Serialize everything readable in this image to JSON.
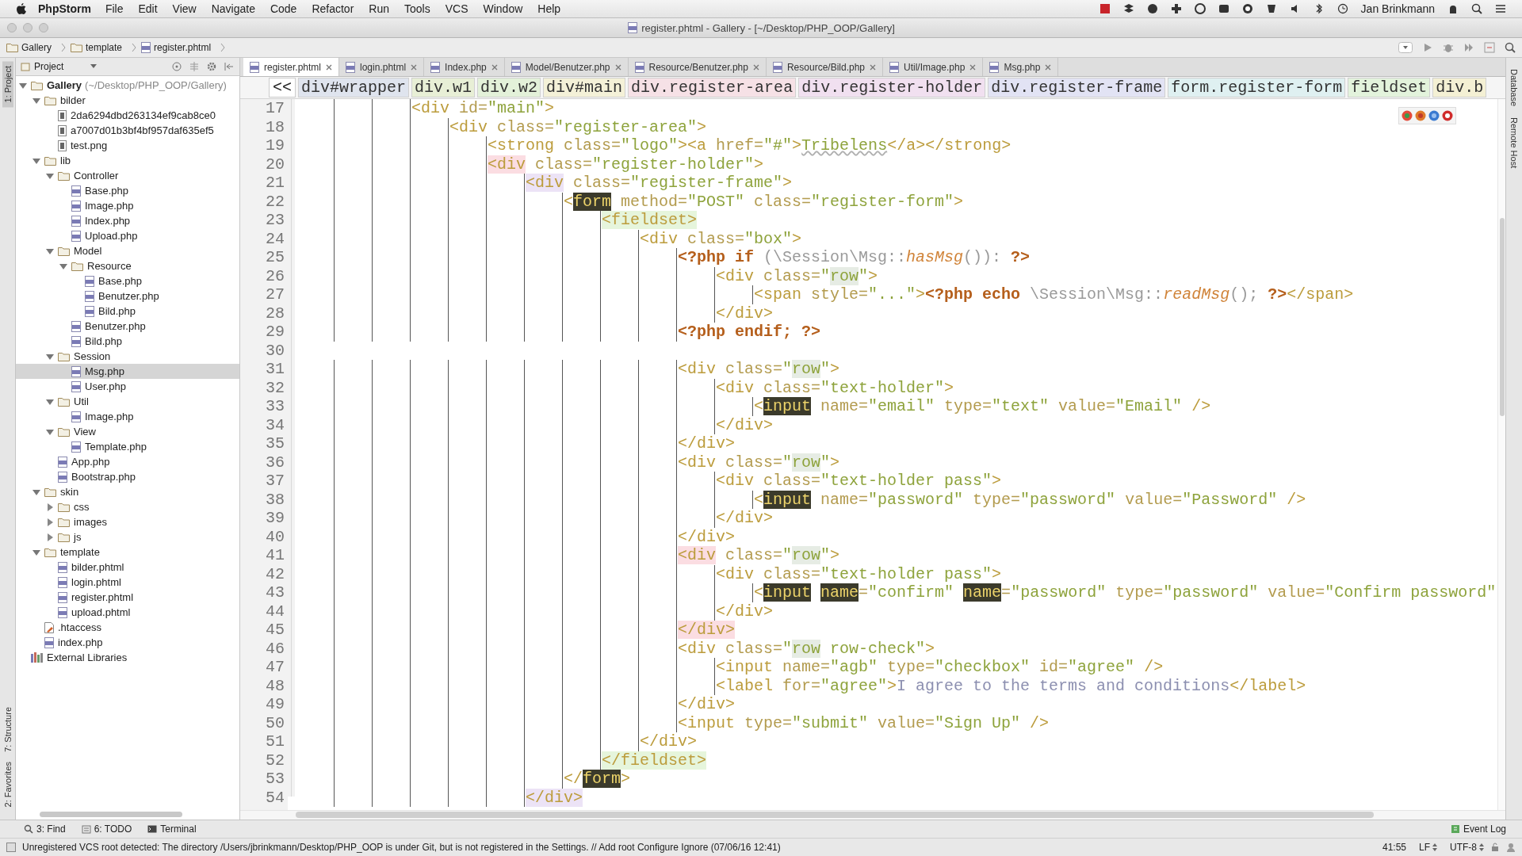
{
  "menu_bar": {
    "app": "PhpStorm",
    "items": [
      "File",
      "Edit",
      "View",
      "Navigate",
      "Code",
      "Refactor",
      "Run",
      "Tools",
      "VCS",
      "Window",
      "Help"
    ],
    "user": "Jan Brinkmann"
  },
  "window": {
    "title": "register.phtml - Gallery - [~/Desktop/PHP_OOP/Gallery]"
  },
  "navigation_bar": [
    {
      "kind": "folder",
      "label": "Gallery"
    },
    {
      "kind": "folder",
      "label": "template"
    },
    {
      "kind": "php",
      "label": "register.phtml"
    }
  ],
  "left_tool_tabs": [
    {
      "label": "1: Project",
      "selected": true
    },
    {
      "label": "7: Structure",
      "selected": false
    },
    {
      "label": "2: Favorites",
      "selected": false
    }
  ],
  "right_tool_tabs": [
    "Database",
    "Remote Host"
  ],
  "project": {
    "view": "Project",
    "tree": [
      {
        "kind": "folder",
        "name": "Gallery",
        "path": "(~/Desktop/PHP_OOP/Gallery)",
        "expanded": true,
        "selected": false,
        "children": [
          {
            "kind": "folder",
            "name": "bilder",
            "expanded": true,
            "selected": false,
            "children": [
              {
                "kind": "file",
                "name": "2da6294dbd263134ef9cab8ce0",
                "selected": false
              },
              {
                "kind": "file",
                "name": "a7007d01b3bf4bf957daf635ef5",
                "selected": false
              },
              {
                "kind": "file",
                "name": "test.png",
                "selected": false
              }
            ]
          },
          {
            "kind": "folder",
            "name": "lib",
            "expanded": true,
            "selected": false,
            "children": [
              {
                "kind": "folder",
                "name": "Controller",
                "expanded": true,
                "selected": false,
                "children": [
                  {
                    "kind": "php",
                    "name": "Base.php",
                    "selected": false
                  },
                  {
                    "kind": "php",
                    "name": "Image.php",
                    "selected": false
                  },
                  {
                    "kind": "php",
                    "name": "Index.php",
                    "selected": false
                  },
                  {
                    "kind": "php",
                    "name": "Upload.php",
                    "selected": false
                  }
                ]
              },
              {
                "kind": "folder",
                "name": "Model",
                "expanded": true,
                "selected": false,
                "children": [
                  {
                    "kind": "folder",
                    "name": "Resource",
                    "expanded": true,
                    "selected": false,
                    "children": [
                      {
                        "kind": "php",
                        "name": "Base.php",
                        "selected": false
                      },
                      {
                        "kind": "php",
                        "name": "Benutzer.php",
                        "selected": false
                      },
                      {
                        "kind": "php",
                        "name": "Bild.php",
                        "selected": false
                      }
                    ]
                  },
                  {
                    "kind": "php",
                    "name": "Benutzer.php",
                    "selected": false
                  },
                  {
                    "kind": "php",
                    "name": "Bild.php",
                    "selected": false
                  }
                ]
              },
              {
                "kind": "folder",
                "name": "Session",
                "expanded": true,
                "selected": false,
                "children": [
                  {
                    "kind": "php",
                    "name": "Msg.php",
                    "selected": true
                  },
                  {
                    "kind": "php",
                    "name": "User.php",
                    "selected": false
                  }
                ]
              },
              {
                "kind": "folder",
                "name": "Util",
                "expanded": true,
                "selected": false,
                "children": [
                  {
                    "kind": "php",
                    "name": "Image.php",
                    "selected": false
                  }
                ]
              },
              {
                "kind": "folder",
                "name": "View",
                "expanded": true,
                "selected": false,
                "children": [
                  {
                    "kind": "php",
                    "name": "Template.php",
                    "selected": false
                  }
                ]
              },
              {
                "kind": "php",
                "name": "App.php",
                "selected": false
              },
              {
                "kind": "php",
                "name": "Bootstrap.php",
                "selected": false
              }
            ]
          },
          {
            "kind": "folder",
            "name": "skin",
            "expanded": true,
            "selected": false,
            "children": [
              {
                "kind": "folder",
                "name": "css",
                "expanded": false,
                "selected": false
              },
              {
                "kind": "folder",
                "name": "images",
                "expanded": false,
                "selected": false
              },
              {
                "kind": "folder",
                "name": "js",
                "expanded": false,
                "selected": false
              }
            ]
          },
          {
            "kind": "folder",
            "name": "template",
            "expanded": true,
            "selected": false,
            "children": [
              {
                "kind": "php",
                "name": "bilder.phtml",
                "selected": false
              },
              {
                "kind": "php",
                "name": "login.phtml",
                "selected": false
              },
              {
                "kind": "php",
                "name": "register.phtml",
                "selected": false
              },
              {
                "kind": "php",
                "name": "upload.phtml",
                "selected": false
              }
            ]
          },
          {
            "kind": "config",
            "name": ".htaccess",
            "selected": false
          },
          {
            "kind": "php",
            "name": "index.php",
            "selected": false
          }
        ]
      },
      {
        "kind": "library",
        "name": "External Libraries",
        "selected": false
      }
    ]
  },
  "editor_tabs": [
    {
      "label": "register.phtml",
      "selected": true
    },
    {
      "label": "login.phtml",
      "selected": false
    },
    {
      "label": "Index.php",
      "selected": false
    },
    {
      "label": "Model/Benutzer.php",
      "selected": false
    },
    {
      "label": "Resource/Benutzer.php",
      "selected": false
    },
    {
      "label": "Resource/Bild.php",
      "selected": false
    },
    {
      "label": "Util/Image.php",
      "selected": false
    },
    {
      "label": "Msg.php",
      "selected": false
    }
  ],
  "structure_path": {
    "back": "<<",
    "items": [
      {
        "label": "div#wrapper",
        "color": "#dfe4ee"
      },
      {
        "label": "div.w1",
        "color": "#e8efd6"
      },
      {
        "label": "div.w2",
        "color": "#e3f1d9"
      },
      {
        "label": "div#main",
        "color": "#f4f1d8"
      },
      {
        "label": "div.register-area",
        "color": "#f6e1e6"
      },
      {
        "label": "div.register-holder",
        "color": "#f1e0f0"
      },
      {
        "label": "div.register-frame",
        "color": "#e2e3f4"
      },
      {
        "label": "form.register-form",
        "color": "#dff0f1"
      },
      {
        "label": "fieldset",
        "color": "#e3f3dc"
      },
      {
        "label": "div.b",
        "color": "#f4f0d4"
      }
    ]
  },
  "code_lines": [
    {
      "number": "17",
      "tokens": [
        {
          "kind": "tag",
          "text": "            <div"
        },
        {
          "kind": "attr",
          "text": " id="
        },
        {
          "kind": "str",
          "text": "\"main\""
        },
        {
          "kind": "tag",
          "text": ">"
        }
      ]
    },
    {
      "number": "18",
      "tokens": [
        {
          "kind": "tag",
          "text": "                <div"
        },
        {
          "kind": "attr",
          "text": " class="
        },
        {
          "kind": "str",
          "text": "\"register-area\""
        },
        {
          "kind": "tag",
          "text": ">"
        }
      ]
    },
    {
      "number": "19",
      "tokens": [
        {
          "kind": "tag",
          "text": "                    <strong"
        },
        {
          "kind": "attr",
          "text": " class="
        },
        {
          "kind": "str",
          "text": "\"logo\""
        },
        {
          "kind": "tag",
          "text": "><a"
        },
        {
          "kind": "attr",
          "text": " href="
        },
        {
          "kind": "str",
          "text": "\"#\""
        },
        {
          "kind": "tag",
          "text": ">"
        },
        {
          "kind": "link",
          "text": "Tribelens"
        },
        {
          "kind": "tag",
          "text": "</a></strong>"
        }
      ]
    },
    {
      "number": "20",
      "tokens": [
        {
          "kind": "tag-pink",
          "text": "                    <div"
        },
        {
          "kind": "attr",
          "text": " class="
        },
        {
          "kind": "str",
          "text": "\"register-holder\""
        },
        {
          "kind": "tag",
          "text": ">"
        }
      ]
    },
    {
      "number": "21",
      "tokens": [
        {
          "kind": "tag-lilac",
          "text": "                        <div"
        },
        {
          "kind": "attr",
          "text": " class="
        },
        {
          "kind": "str",
          "text": "\"register-frame\""
        },
        {
          "kind": "tag",
          "text": ">"
        }
      ]
    },
    {
      "number": "22",
      "tokens": [
        {
          "kind": "tag",
          "text": "                            <"
        },
        {
          "kind": "tag-dark",
          "text": "form"
        },
        {
          "kind": "attr",
          "text": " method="
        },
        {
          "kind": "str",
          "text": "\"POST\""
        },
        {
          "kind": "attr",
          "text": " class="
        },
        {
          "kind": "str",
          "text": "\"register-form\""
        },
        {
          "kind": "tag",
          "text": ">"
        }
      ]
    },
    {
      "number": "23",
      "tokens": [
        {
          "kind": "tag-green",
          "text": "                                <fieldset>"
        }
      ]
    },
    {
      "number": "24",
      "tokens": [
        {
          "kind": "tag",
          "text": "                                    <div"
        },
        {
          "kind": "attr",
          "text": " class="
        },
        {
          "kind": "str",
          "text": "\"box\""
        },
        {
          "kind": "tag",
          "text": ">"
        }
      ]
    },
    {
      "number": "25",
      "tokens": [
        {
          "kind": "php",
          "text": "                                        <?php if"
        },
        {
          "kind": "ns",
          "text": " (\\Session\\Msg::"
        },
        {
          "kind": "method",
          "text": "hasMsg"
        },
        {
          "kind": "ns",
          "text": "()):"
        },
        {
          "kind": "php",
          "text": " ?>"
        }
      ]
    },
    {
      "number": "26",
      "tokens": [
        {
          "kind": "tag",
          "text": "                                            <div"
        },
        {
          "kind": "attr",
          "text": " class="
        },
        {
          "kind": "str",
          "text": "\""
        },
        {
          "kind": "word",
          "text": "row"
        },
        {
          "kind": "str",
          "text": "\""
        },
        {
          "kind": "tag",
          "text": ">"
        }
      ]
    },
    {
      "number": "27",
      "tokens": [
        {
          "kind": "tag",
          "text": "                                                <span"
        },
        {
          "kind": "attr",
          "text": " style="
        },
        {
          "kind": "str",
          "text": "\"...\""
        },
        {
          "kind": "tag",
          "text": ">"
        },
        {
          "kind": "php",
          "text": "<?php echo"
        },
        {
          "kind": "ns",
          "text": " \\Session\\Msg::"
        },
        {
          "kind": "method",
          "text": "readMsg"
        },
        {
          "kind": "ns",
          "text": "();"
        },
        {
          "kind": "php",
          "text": " ?>"
        },
        {
          "kind": "tag",
          "text": "</span>"
        }
      ]
    },
    {
      "number": "28",
      "tokens": [
        {
          "kind": "tag",
          "text": "                                            </div>"
        }
      ]
    },
    {
      "number": "29",
      "tokens": [
        {
          "kind": "php",
          "text": "                                        <?php endif; ?>"
        }
      ]
    },
    {
      "number": "30"
    },
    {
      "number": "31",
      "tokens": [
        {
          "kind": "tag",
          "text": "                                        <div"
        },
        {
          "kind": "attr",
          "text": " class="
        },
        {
          "kind": "str",
          "text": "\""
        },
        {
          "kind": "word",
          "text": "row"
        },
        {
          "kind": "str",
          "text": "\""
        },
        {
          "kind": "tag",
          "text": ">"
        }
      ]
    },
    {
      "number": "32",
      "tokens": [
        {
          "kind": "tag",
          "text": "                                            <div"
        },
        {
          "kind": "attr",
          "text": " class="
        },
        {
          "kind": "str",
          "text": "\"text-holder\""
        },
        {
          "kind": "tag",
          "text": ">"
        }
      ]
    },
    {
      "number": "33",
      "tokens": [
        {
          "kind": "tag",
          "text": "                                                <"
        },
        {
          "kind": "tag-dark",
          "text": "input"
        },
        {
          "kind": "attr",
          "text": " name="
        },
        {
          "kind": "str",
          "text": "\"email\""
        },
        {
          "kind": "attr",
          "text": " type="
        },
        {
          "kind": "str",
          "text": "\"text\""
        },
        {
          "kind": "attr",
          "text": " value="
        },
        {
          "kind": "str",
          "text": "\"Email\""
        },
        {
          "kind": "tag",
          "text": " />"
        }
      ]
    },
    {
      "number": "34",
      "tokens": [
        {
          "kind": "tag",
          "text": "                                            </div>"
        }
      ]
    },
    {
      "number": "35",
      "tokens": [
        {
          "kind": "tag",
          "text": "                                        </div>"
        }
      ]
    },
    {
      "number": "36",
      "tokens": [
        {
          "kind": "tag",
          "text": "                                        <div"
        },
        {
          "kind": "attr",
          "text": " class="
        },
        {
          "kind": "str",
          "text": "\""
        },
        {
          "kind": "word",
          "text": "row"
        },
        {
          "kind": "str",
          "text": "\""
        },
        {
          "kind": "tag",
          "text": ">"
        }
      ]
    },
    {
      "number": "37",
      "tokens": [
        {
          "kind": "tag",
          "text": "                                            <div"
        },
        {
          "kind": "attr",
          "text": " class="
        },
        {
          "kind": "str",
          "text": "\"text-holder pass\""
        },
        {
          "kind": "tag",
          "text": ">"
        }
      ]
    },
    {
      "number": "38",
      "tokens": [
        {
          "kind": "tag",
          "text": "                                                <"
        },
        {
          "kind": "tag-dark",
          "text": "input"
        },
        {
          "kind": "attr",
          "text": " name="
        },
        {
          "kind": "str",
          "text": "\"password\""
        },
        {
          "kind": "attr",
          "text": " type="
        },
        {
          "kind": "str",
          "text": "\"password\""
        },
        {
          "kind": "attr",
          "text": " value="
        },
        {
          "kind": "str",
          "text": "\"Password\""
        },
        {
          "kind": "tag",
          "text": " />"
        }
      ]
    },
    {
      "number": "39",
      "tokens": [
        {
          "kind": "tag",
          "text": "                                            </div>"
        }
      ]
    },
    {
      "number": "40",
      "tokens": [
        {
          "kind": "tag",
          "text": "                                        </div>"
        }
      ]
    },
    {
      "number": "41",
      "tokens": [
        {
          "kind": "tag-pink",
          "text": "                                        <div"
        },
        {
          "kind": "attr",
          "text": " class="
        },
        {
          "kind": "str",
          "text": "\""
        },
        {
          "kind": "word",
          "text": "row"
        },
        {
          "kind": "str",
          "text": "\""
        },
        {
          "kind": "tag",
          "text": ">"
        }
      ]
    },
    {
      "number": "42",
      "tokens": [
        {
          "kind": "tag",
          "text": "                                            <div"
        },
        {
          "kind": "attr",
          "text": " class="
        },
        {
          "kind": "str",
          "text": "\"text-holder pass\""
        },
        {
          "kind": "tag",
          "text": ">"
        }
      ]
    },
    {
      "number": "43",
      "tokens": [
        {
          "kind": "tag",
          "text": "                                                <"
        },
        {
          "kind": "tag-dark",
          "text": "input"
        },
        {
          "kind": "tag-dark-spaced",
          "text": "name"
        },
        {
          "kind": "attr",
          "text": "="
        },
        {
          "kind": "str",
          "text": "\"confirm\""
        },
        {
          "kind": "tag-dark-spaced",
          "text": "name"
        },
        {
          "kind": "attr",
          "text": "="
        },
        {
          "kind": "str",
          "text": "\"password\""
        },
        {
          "kind": "attr",
          "text": " type="
        },
        {
          "kind": "str",
          "text": "\"password\""
        },
        {
          "kind": "attr",
          "text": " value="
        },
        {
          "kind": "str",
          "text": "\"Confirm password\""
        }
      ]
    },
    {
      "number": "44",
      "tokens": [
        {
          "kind": "tag",
          "text": "                                            </div>"
        }
      ]
    },
    {
      "number": "45",
      "tokens": [
        {
          "kind": "tag-pink",
          "text": "                                        </div>"
        }
      ]
    },
    {
      "number": "46",
      "tokens": [
        {
          "kind": "tag",
          "text": "                                        <div"
        },
        {
          "kind": "attr",
          "text": " class="
        },
        {
          "kind": "str",
          "text": "\""
        },
        {
          "kind": "word",
          "text": "row"
        },
        {
          "kind": "str",
          "text": " row-check\""
        },
        {
          "kind": "tag",
          "text": ">"
        }
      ]
    },
    {
      "number": "47",
      "tokens": [
        {
          "kind": "tag",
          "text": "                                            <input"
        },
        {
          "kind": "attr",
          "text": " name="
        },
        {
          "kind": "str",
          "text": "\"agb\""
        },
        {
          "kind": "attr",
          "text": " type="
        },
        {
          "kind": "str",
          "text": "\"checkbox\""
        },
        {
          "kind": "attr",
          "text": " id="
        },
        {
          "kind": "str",
          "text": "\"agree\""
        },
        {
          "kind": "tag",
          "text": " />"
        }
      ]
    },
    {
      "number": "48",
      "tokens": [
        {
          "kind": "tag",
          "text": "                                            <label"
        },
        {
          "kind": "attr",
          "text": " for="
        },
        {
          "kind": "str",
          "text": "\"agree\""
        },
        {
          "kind": "tag",
          "text": ">"
        },
        {
          "kind": "text",
          "text": "I agree to the terms and conditions"
        },
        {
          "kind": "tag",
          "text": "</label>"
        }
      ]
    },
    {
      "number": "49",
      "tokens": [
        {
          "kind": "tag",
          "text": "                                        </div>"
        }
      ]
    },
    {
      "number": "50",
      "tokens": [
        {
          "kind": "tag",
          "text": "                                        <input"
        },
        {
          "kind": "attr",
          "text": " type="
        },
        {
          "kind": "str",
          "text": "\"submit\""
        },
        {
          "kind": "attr",
          "text": " value="
        },
        {
          "kind": "str",
          "text": "\"Sign Up\""
        },
        {
          "kind": "tag",
          "text": " />"
        }
      ]
    },
    {
      "number": "51",
      "tokens": [
        {
          "kind": "tag",
          "text": "                                    </div>"
        }
      ]
    },
    {
      "number": "52",
      "tokens": [
        {
          "kind": "tag-green",
          "text": "                                </fieldset>"
        }
      ]
    },
    {
      "number": "53",
      "tokens": [
        {
          "kind": "tag",
          "text": "                            </"
        },
        {
          "kind": "tag-dark",
          "text": "form"
        },
        {
          "kind": "tag",
          "text": ">"
        }
      ]
    },
    {
      "number": "54",
      "tokens": [
        {
          "kind": "tag-lilac",
          "text": "                        </div>"
        }
      ]
    }
  ],
  "bottom_tools": [
    {
      "label": "3: Find"
    },
    {
      "label": "6: TODO"
    },
    {
      "label": "Terminal"
    }
  ],
  "event_log": "Event Log",
  "status_bar": {
    "message": "Unregistered VCS root detected: The directory /Users/jbrinkmann/Desktop/PHP_OOP is under Git, but is not registered in the Settings. // Add root  Configure  Ignore (07/06/16 12:41)",
    "position": "41:55",
    "line_separator": "LF",
    "encoding": "UTF-8"
  }
}
